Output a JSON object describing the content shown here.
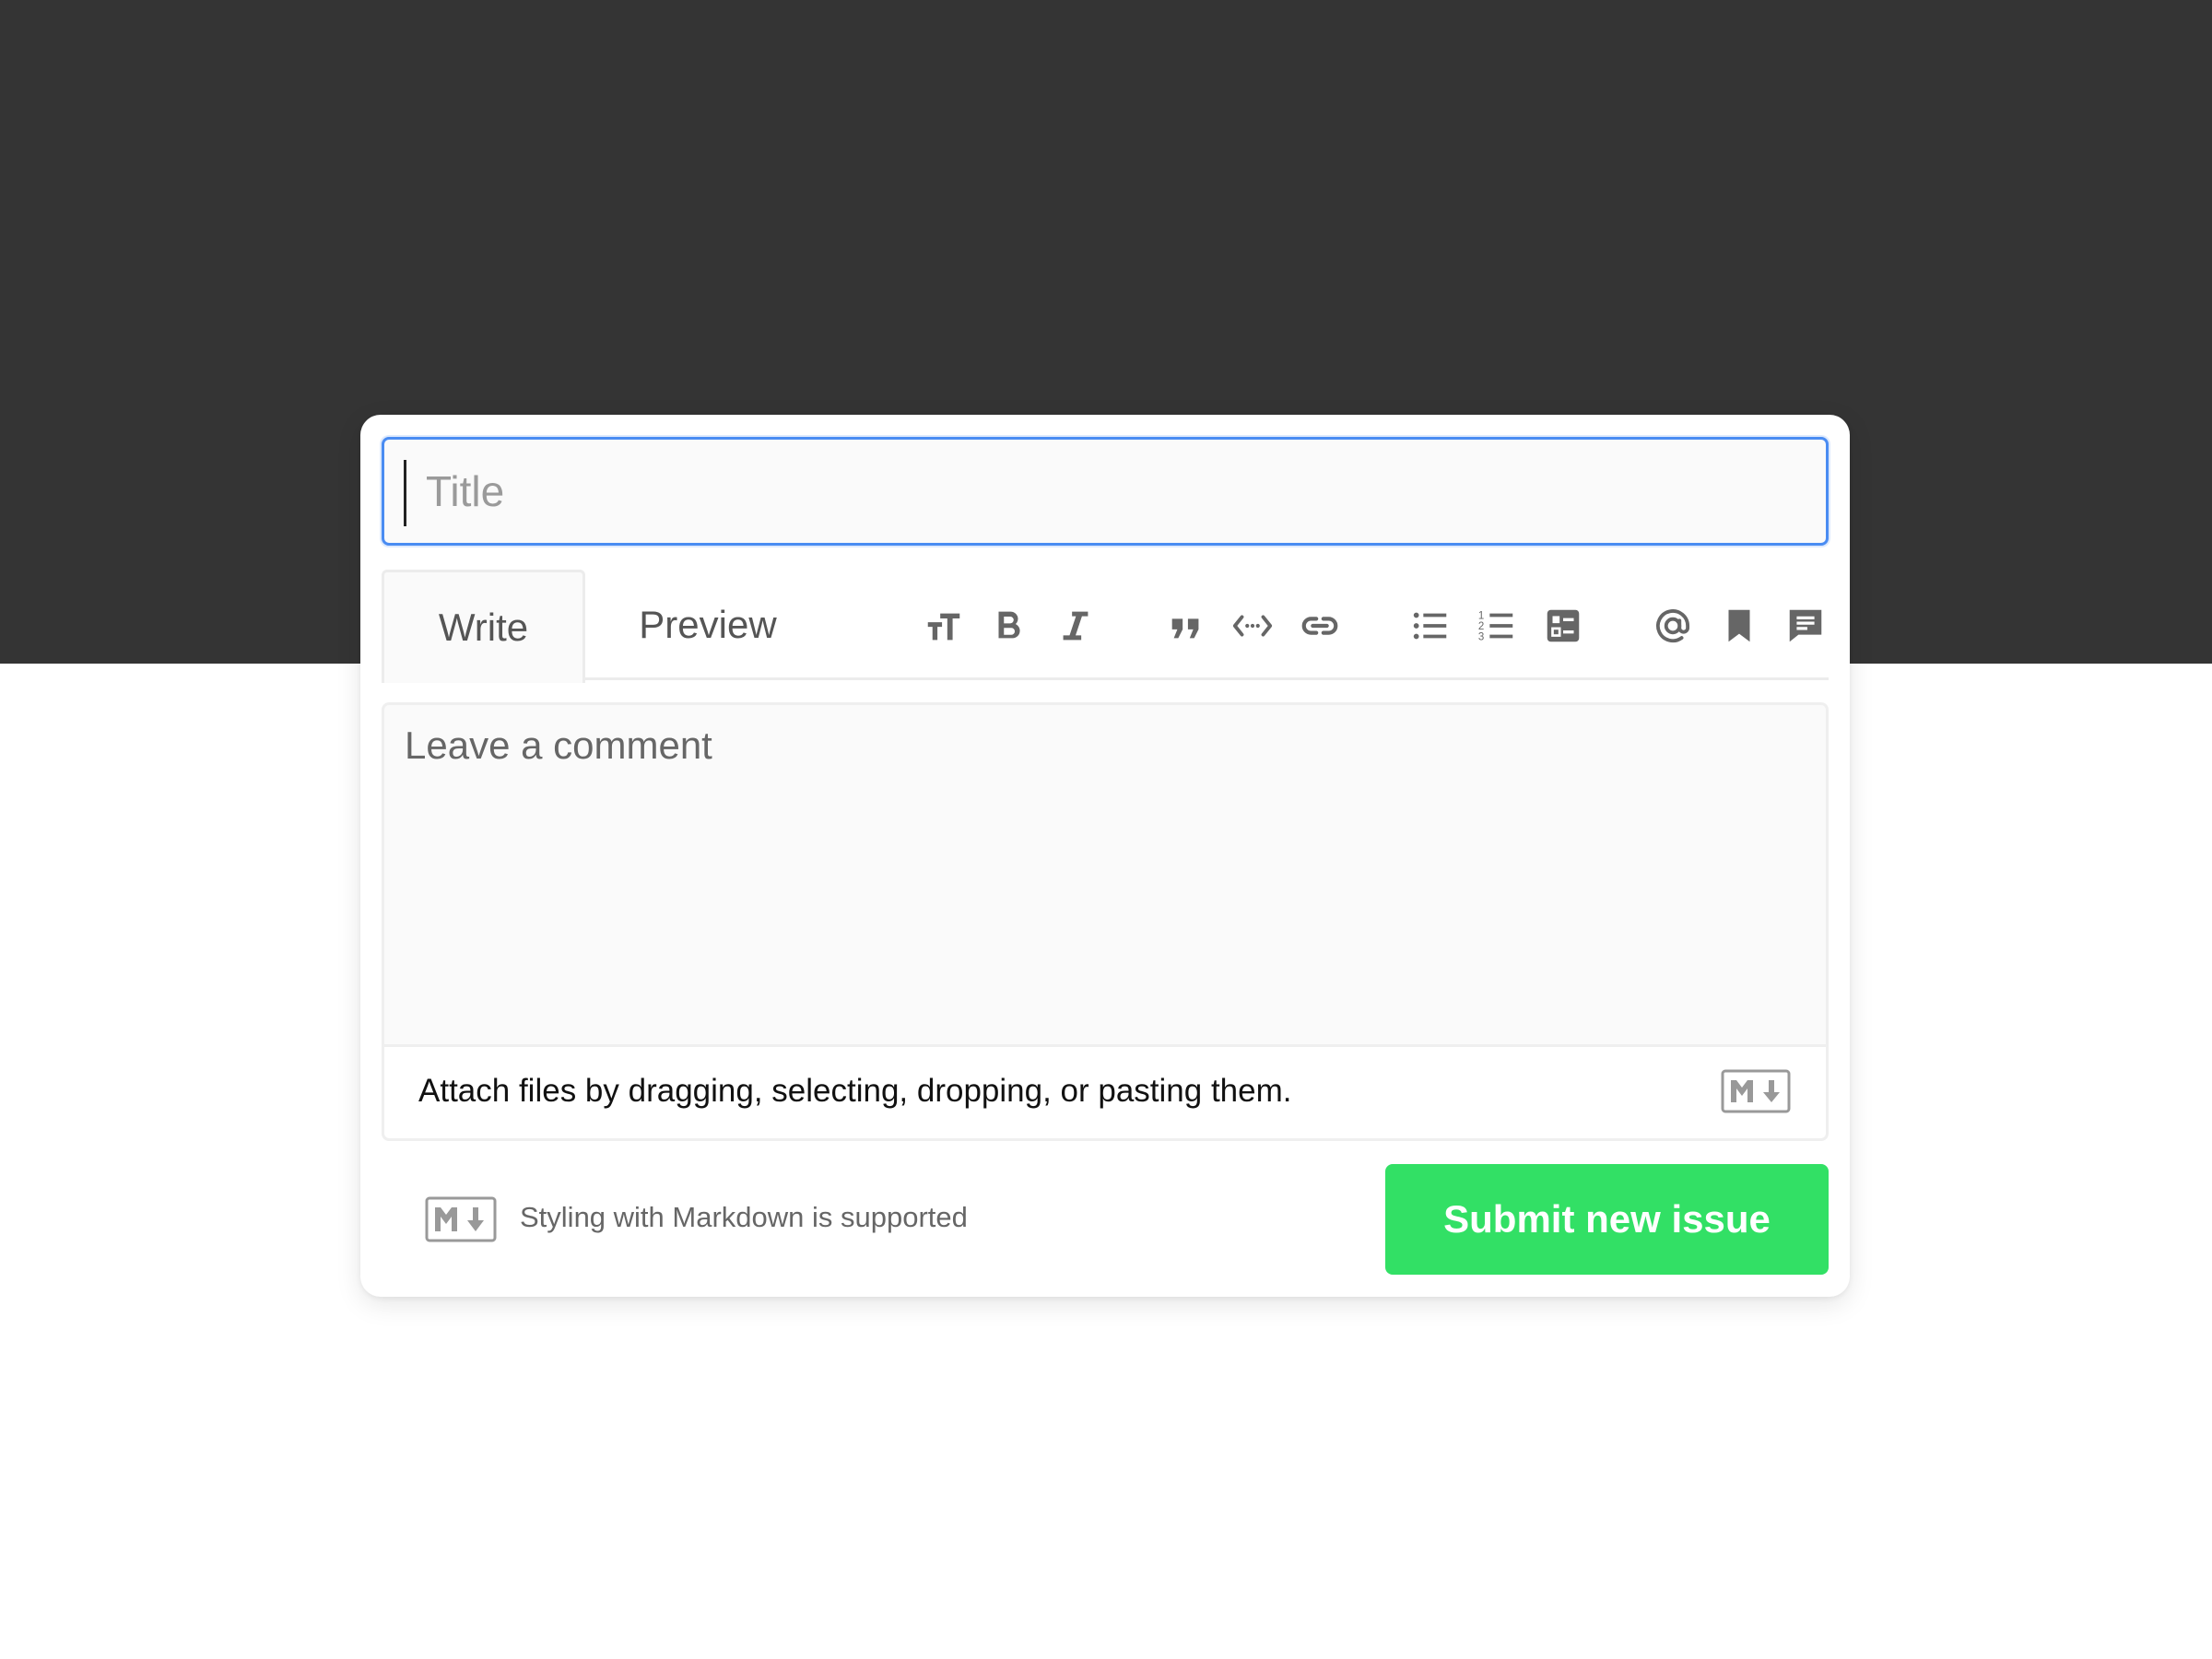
{
  "title_field": {
    "placeholder": "Title",
    "value": ""
  },
  "tabs": [
    {
      "label": "Write",
      "active": true
    },
    {
      "label": "Preview",
      "active": false
    }
  ],
  "toolbar": [
    {
      "icon": "text-size-icon",
      "action": "heading"
    },
    {
      "icon": "bold-icon",
      "action": "bold"
    },
    {
      "icon": "italic-icon",
      "action": "italic"
    },
    {
      "icon": "quote-icon",
      "action": "quote"
    },
    {
      "icon": "code-icon",
      "action": "code"
    },
    {
      "icon": "link-icon",
      "action": "link"
    },
    {
      "icon": "bulleted-list-icon",
      "action": "unordered-list"
    },
    {
      "icon": "numbered-list-icon",
      "action": "ordered-list"
    },
    {
      "icon": "task-list-icon",
      "action": "task-list"
    },
    {
      "icon": "mention-icon",
      "action": "mention"
    },
    {
      "icon": "bookmark-icon",
      "action": "reference"
    },
    {
      "icon": "saved-reply-icon",
      "action": "saved-reply"
    }
  ],
  "comment": {
    "placeholder": "Leave a comment",
    "value": "",
    "attach_text": "Attach files by dragging, selecting, dropping, or pasting them."
  },
  "footer": {
    "markdown_note": "Styling with Markdown is supported",
    "submit_label": "Submit new issue"
  },
  "colors": {
    "background_top": "#343434",
    "focus_border": "#4a8cf2",
    "submit_bg": "#32e065",
    "icon": "#666666"
  }
}
